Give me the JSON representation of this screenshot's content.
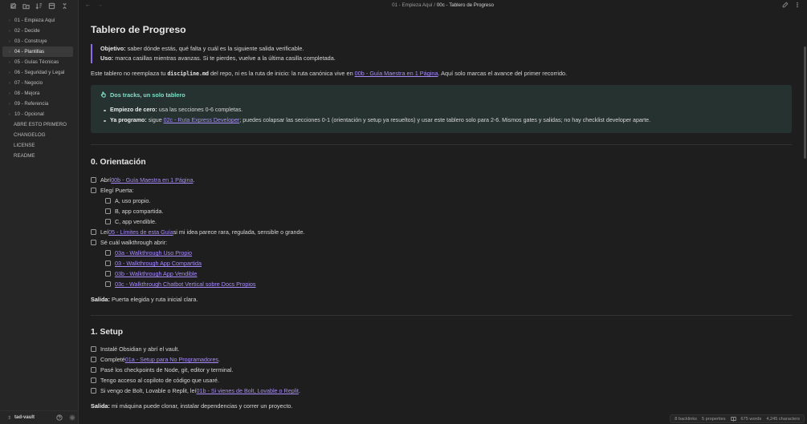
{
  "sidebar": {
    "items": [
      {
        "label": "01 - Empieza Aquí",
        "type": "folder",
        "active": false
      },
      {
        "label": "02 - Decide",
        "type": "folder",
        "active": false
      },
      {
        "label": "03 - Construye",
        "type": "folder",
        "active": false
      },
      {
        "label": "04 - Plantillas",
        "type": "folder",
        "active": true
      },
      {
        "label": "05 - Guías Técnicas",
        "type": "folder",
        "active": false
      },
      {
        "label": "06 - Seguridad y Legal",
        "type": "folder",
        "active": false
      },
      {
        "label": "07 - Negocio",
        "type": "folder",
        "active": false
      },
      {
        "label": "08 - Mejora",
        "type": "folder",
        "active": false
      },
      {
        "label": "09 - Referencia",
        "type": "folder",
        "active": false
      },
      {
        "label": "10 - Opcional",
        "type": "folder",
        "active": false
      },
      {
        "label": "ABRE ESTO PRIMERO",
        "type": "file",
        "active": false
      },
      {
        "label": "CHANGELOG",
        "type": "file",
        "active": false
      },
      {
        "label": "LICENSE",
        "type": "file",
        "active": false
      },
      {
        "label": "README",
        "type": "file",
        "active": false
      }
    ],
    "vault_name": "tad-vault"
  },
  "breadcrumb": {
    "folder": "01 - Empieza Aquí",
    "separator": "/",
    "current": "00c - Tablero de Progreso"
  },
  "doc": {
    "title": "Tablero de Progreso",
    "quote": {
      "objetivo_label": "Objetivo:",
      "objetivo_text": " saber dónde estás, qué falta y cuál es la siguiente salida verificable.",
      "uso_label": "Uso:",
      "uso_text": " marca casillas mientras avanzas. Si te pierdes, vuelve a la última casilla completada."
    },
    "intro": {
      "t1": "Este tablero no reemplaza tu ",
      "code": "discipline.md",
      "t2": " del repo, ni es la ruta de inicio: la ruta canónica vive en ",
      "link": "00b - Guía Maestra en 1 Página",
      "t3": ". Aquí solo marcas el avance del primer recorrido."
    },
    "callout": {
      "title": "Dos tracks, un solo tablero",
      "b1_label": "Empiezo de cero:",
      "b1_text": " usa las secciones 0-6 completas.",
      "b2_label": "Ya programo:",
      "b2_t1": " sigue ",
      "b2_link": "02c - Ruta Express Developer",
      "b2_t2": "; puedes colapsar las secciones 0-1 (orientación y setup ya resueltos) y usar este tablero solo para 2-6. Mismos gates y salidas; no hay checklist developer aparte."
    },
    "s0": {
      "heading": "0. Orientación",
      "t1_a": "Abrí ",
      "t1_link": "00b - Guía Maestra en 1 Página",
      "t1_b": ".",
      "t2": "Elegí Puerta:",
      "t2a": "A, uso propio.",
      "t2b": "B, app compartida.",
      "t2c": "C, app vendible.",
      "t3_a": "Leí ",
      "t3_link": "05 - Límites de esta Guía",
      "t3_b": " si mi idea parece rara, regulada, sensible o grande.",
      "t4": "Sé cuál walkthrough abrir:",
      "w1": "03a - Walkthrough Uso Propio",
      "w2": "03 - Walkthrough App Compartida",
      "w3": "03b - Walkthrough App Vendible",
      "w4": "03c - Walkthrough Chatbot Vertical sobre Docs Propios",
      "salida_label": "Salida:",
      "salida_text": " Puerta elegida y ruta inicial clara."
    },
    "s1": {
      "heading": "1. Setup",
      "t1": "Instalé Obsidian y abrí el vault.",
      "t2_a": "Completé ",
      "t2_link": "01a - Setup para No Programadores",
      "t2_b": ".",
      "t3": "Pasé los checkpoints de Node, git, editor y terminal.",
      "t4": "Tengo acceso al copiloto de código que usaré.",
      "t5_a": "Si vengo de Bolt, Lovable o Replit, leí ",
      "t5_link": "01b - Si vienes de Bolt, Lovable o Replit",
      "t5_b": ".",
      "salida_label": "Salida:",
      "salida_text": " mi máquina puede clonar, instalar dependencias y correr un proyecto."
    }
  },
  "status": {
    "backlinks": "8 backlinks",
    "properties": "5 properties",
    "words": "675 words",
    "characters": "4,245 characters"
  },
  "nav": {
    "back": "←",
    "forward": "→"
  },
  "colors": {
    "accent": "#a78bfa",
    "callout_bg": "#253230",
    "callout_title": "#7fe0c8"
  }
}
